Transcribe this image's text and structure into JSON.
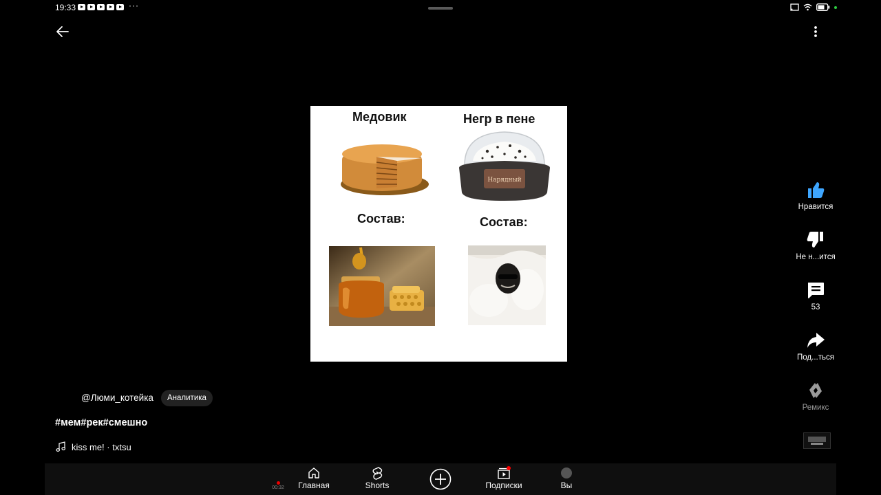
{
  "status_bar": {
    "time": "19:33",
    "more": "···"
  },
  "video": {
    "left_title": "Медовик",
    "right_title": "Негр в пене",
    "left_subtitle": "Состав:",
    "right_subtitle": "Состав:"
  },
  "actions": {
    "like_label": "Нравится",
    "dislike_label": "Не н...ится",
    "comments_count": "53",
    "share_label": "Под...ться",
    "remix_label": "Ремикс"
  },
  "channel": {
    "name": "@Люми_котейка",
    "analytics_label": "Аналитика"
  },
  "caption": {
    "hashtags": "#мем#рек#смешно"
  },
  "music": {
    "track": "kiss me! · txtsu"
  },
  "nav": {
    "home": "Главная",
    "shorts": "Shorts",
    "subscriptions": "Подписки",
    "you": "Вы"
  },
  "recording": {
    "time": "00:32"
  },
  "icons": {
    "back": "arrow-left-icon",
    "menu": "kebab-menu-icon",
    "like": "thumbs-up-icon",
    "dislike": "thumbs-down-icon",
    "comments": "comment-icon",
    "share": "share-arrow-icon",
    "remix": "remix-icon",
    "music": "music-note-icon",
    "home": "home-icon",
    "shorts": "shorts-icon",
    "create": "plus-circle-icon",
    "subscriptions": "subscriptions-icon"
  },
  "colors": {
    "background": "#000000",
    "like_active": "#3ea6ff",
    "notification": "#ff0000",
    "nav_background": "#0f0f0f",
    "chip_background": "#222222"
  }
}
